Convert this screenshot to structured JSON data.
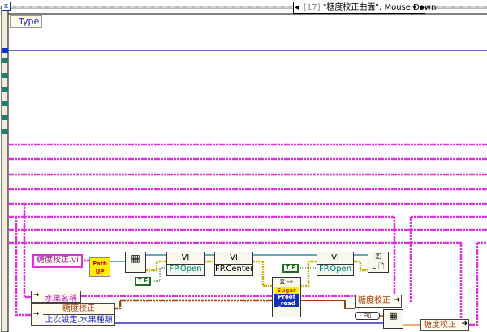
{
  "event_selector": {
    "index": "[17]",
    "label": "\"糖度校正曲面\": Mouse Down"
  },
  "event_data_node": {
    "type_label": "Type"
  },
  "vi_name_constant": "糖度校正.vi",
  "path_up_node": {
    "line1": "Path",
    "line2": "UP"
  },
  "fp_open_1": {
    "top": "VI",
    "label": "FP.Open"
  },
  "fp_center": {
    "top": "VI",
    "label": "FP.Center"
  },
  "fp_open_2": {
    "top": "VI",
    "label": "FP.Open"
  },
  "sugar_proof_subvi": {
    "line1": "Sugar",
    "line2": "Proof",
    "line3": "_read"
  },
  "unbundle_1": {
    "field": "水果名稱"
  },
  "unbundle_2": {
    "fields": [
      "糖度校正",
      "上次設定.水果種類"
    ]
  },
  "bundle_1": {
    "field": "糖度校正"
  },
  "bundle_2": {
    "field": "糖度校正"
  },
  "bool_constant": "T F",
  "colors": {
    "cluster_wire": "#e030e0",
    "refnum_wire": "#2e8fa0",
    "error_wire": "#c8b400",
    "blue_wire": "#3030c0",
    "orange_wire": "#a04010"
  }
}
